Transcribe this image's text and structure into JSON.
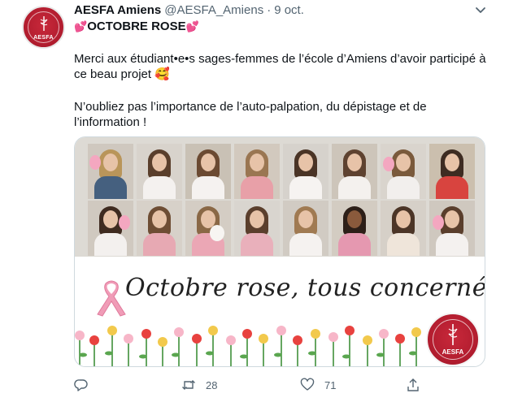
{
  "tweet": {
    "author_name": "AESFA Amiens",
    "handle": "@AESFA_Amiens",
    "separator": "·",
    "date": "9 oct.",
    "title_heart": "💕",
    "title": "OCTOBRE ROSE",
    "body_line1": "Merci aux étudiant•e•s sages-femmes de l’école d’Amiens d’avoir participé à",
    "body_line2": "ce beau projet 🥰",
    "body_line3": "N’oubliez pas l’importance de l’auto-palpation, du dépistage et de",
    "body_line4": "l’information !"
  },
  "avatar": {
    "label": "AESFA"
  },
  "media": {
    "slogan": "Octobre rose, tous concernés",
    "seal_label": "AESFA"
  },
  "actions": {
    "reply_count": "",
    "retweet_count": "28",
    "like_count": "71"
  },
  "colors": {
    "brand_red": "#b41e30",
    "pink": "#f4a7c0",
    "text_secondary": "#536471"
  },
  "icons": {
    "reply": "reply-icon",
    "retweet": "retweet-icon",
    "like": "heart-icon",
    "share": "share-icon",
    "more": "chevron-down-icon"
  }
}
